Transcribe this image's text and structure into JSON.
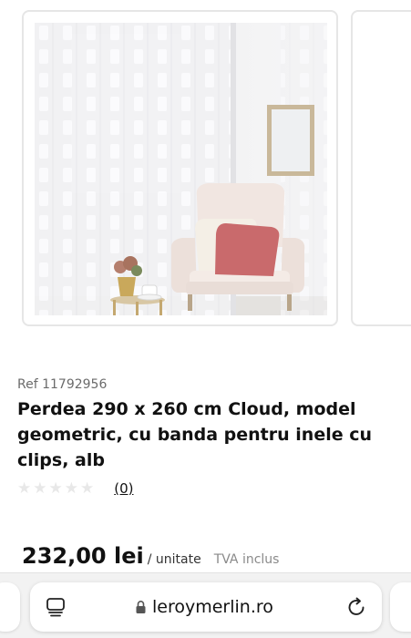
{
  "product": {
    "ref": "Ref 11792956",
    "title": "Perdea 290 x 260 cm Cloud, model geometric, cu banda pentru inele cu clips, alb",
    "rating": {
      "stars_filled": 0,
      "stars_total": 5,
      "review_count": "(0)"
    },
    "price": "232,00 lei",
    "unit": "/ unitate",
    "vat": "TVA inclus"
  },
  "carousel": {
    "image_alt": "Perdea Cloud alb",
    "progress_fraction": 0.14,
    "progress_color": "#188803"
  },
  "browser": {
    "url": "leroymerlin.ro",
    "icons": [
      "tabs-icon",
      "lock-icon",
      "reload-icon"
    ]
  }
}
